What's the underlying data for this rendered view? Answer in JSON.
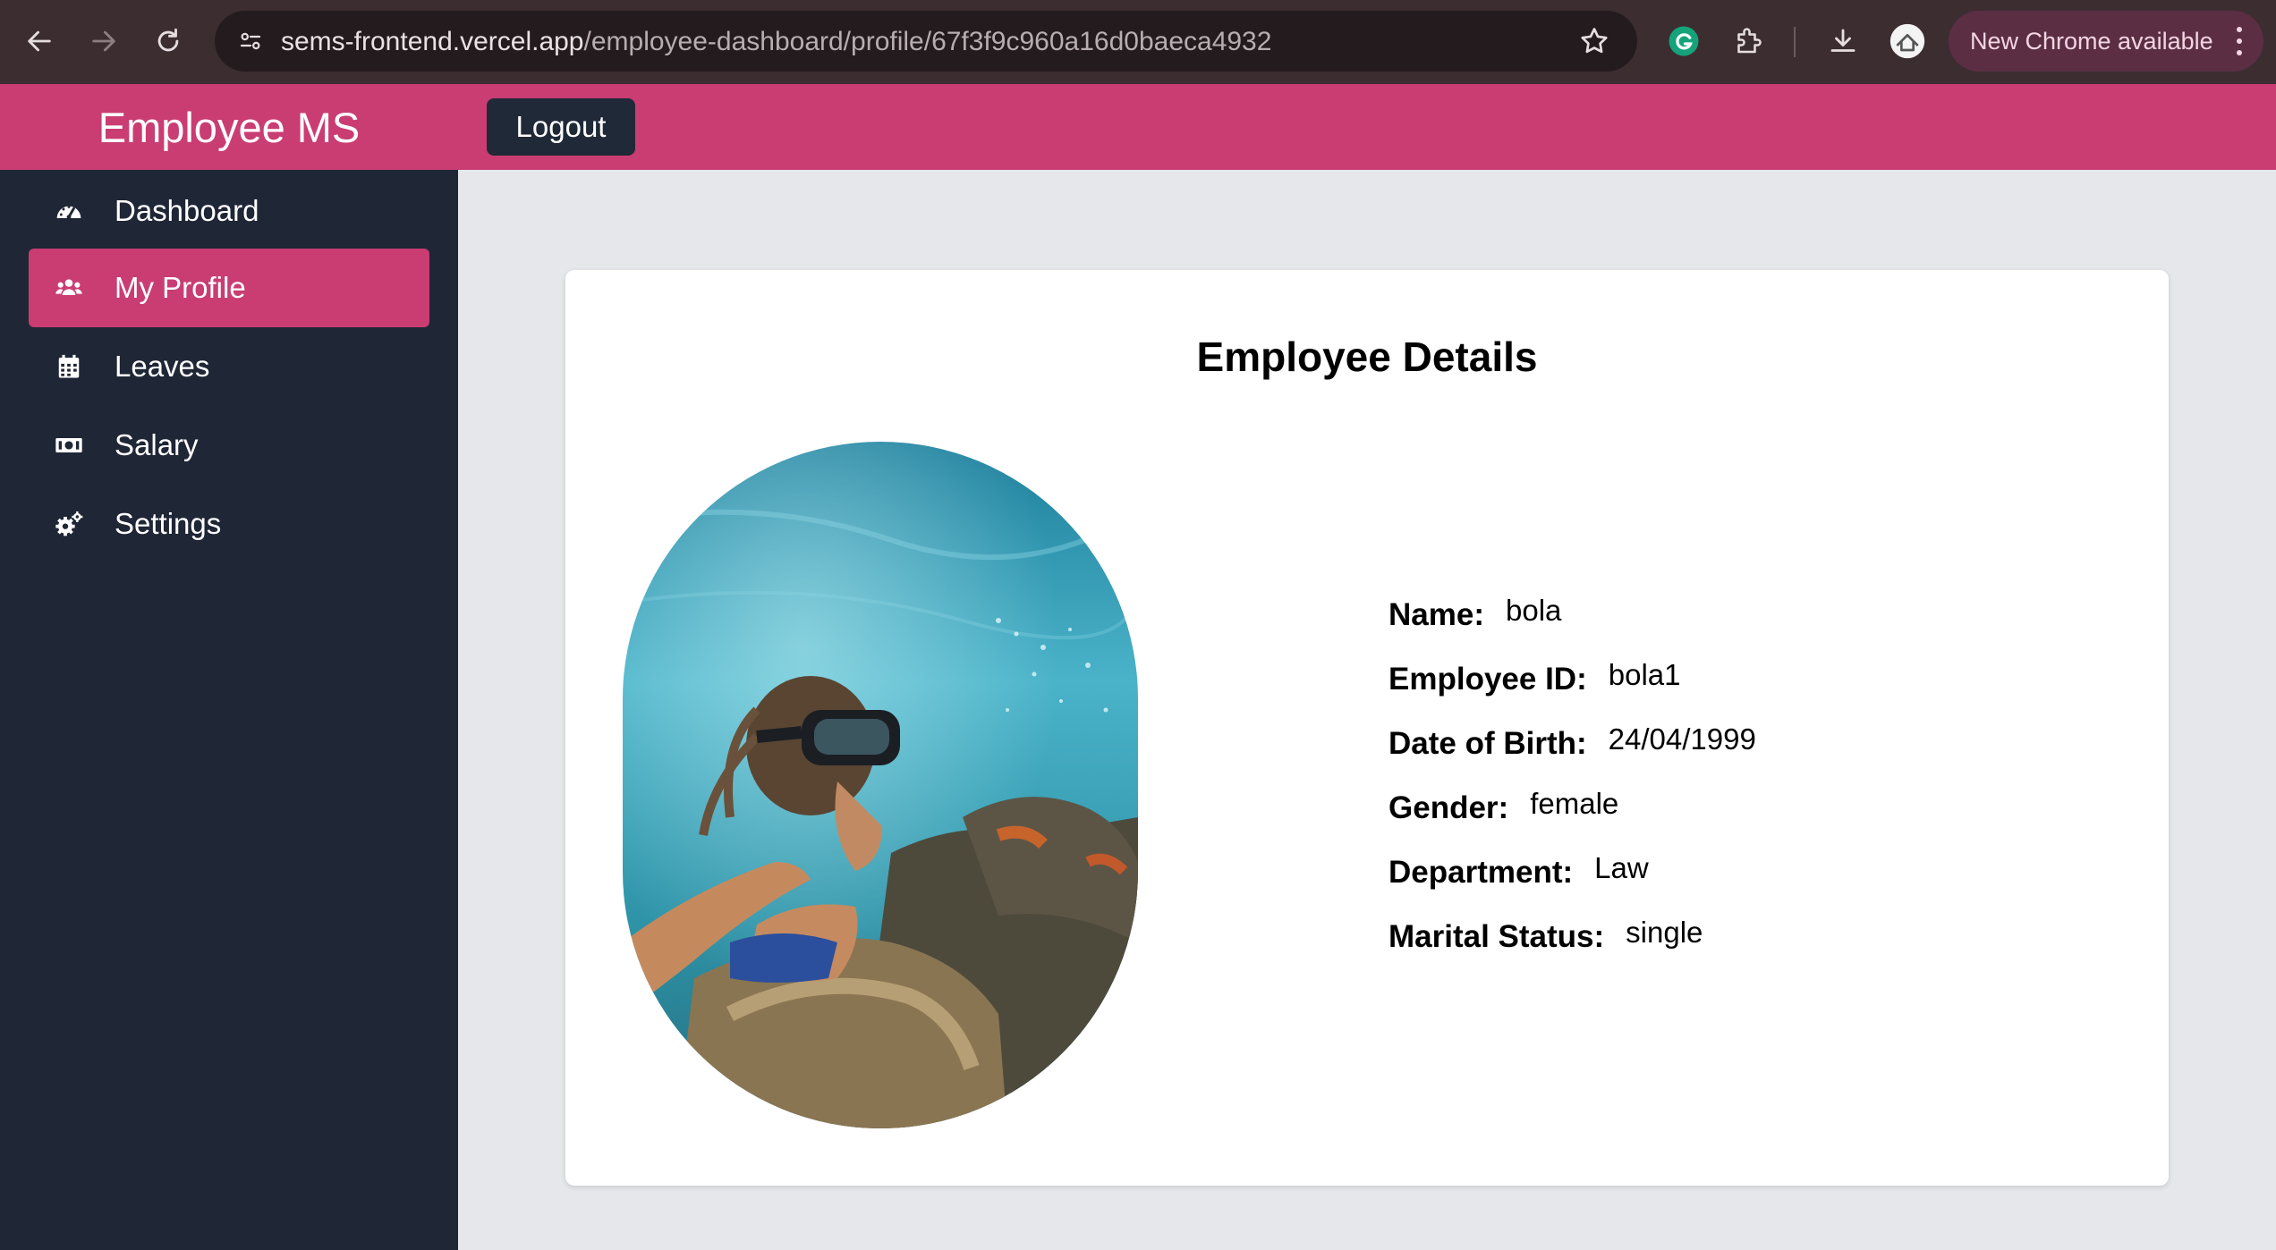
{
  "browser": {
    "url_host": "sems-frontend.vercel.app",
    "url_path": "/employee-dashboard/profile/67f3f9c960a16d0baeca4932",
    "update_label": "New Chrome available",
    "icons": [
      "back-arrow-icon",
      "forward-arrow-icon",
      "reload-icon",
      "site-settings-icon",
      "star-icon",
      "grammarly-icon",
      "extensions-icon",
      "download-icon",
      "profile-avatar-icon",
      "more-vertical-icon"
    ]
  },
  "header": {
    "brand": "Employee MS",
    "logout_label": "Logout",
    "color": "#c93d73"
  },
  "sidebar": {
    "items": [
      {
        "label": "Dashboard",
        "icon": "tachometer-icon",
        "active": false
      },
      {
        "label": "My Profile",
        "icon": "users-icon",
        "active": true
      },
      {
        "label": "Leaves",
        "icon": "calendar-icon",
        "active": false
      },
      {
        "label": "Salary",
        "icon": "money-bill-icon",
        "active": false
      },
      {
        "label": "Settings",
        "icon": "cogs-icon",
        "active": false
      }
    ],
    "background": "#1f2635",
    "active_color": "#c93d73"
  },
  "profile": {
    "title": "Employee Details",
    "photo_alt": "underwater snorkeling selfie",
    "fields": [
      {
        "label": "Name:",
        "value": "bola"
      },
      {
        "label": "Employee ID:",
        "value": "bola1"
      },
      {
        "label": "Date of Birth:",
        "value": "24/04/1999"
      },
      {
        "label": "Gender:",
        "value": "female"
      },
      {
        "label": "Department:",
        "value": "Law"
      },
      {
        "label": "Marital Status:",
        "value": "single"
      }
    ]
  }
}
